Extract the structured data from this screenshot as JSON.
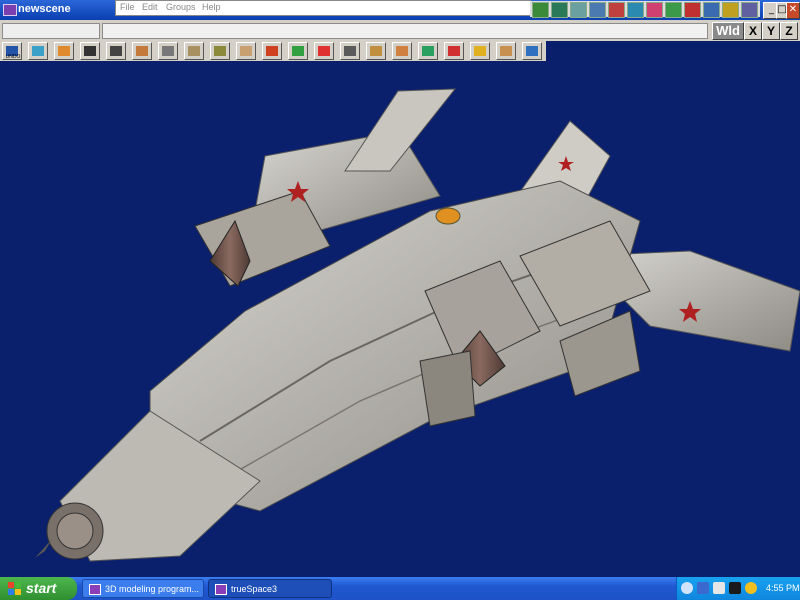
{
  "window": {
    "title": "newscene"
  },
  "menu": [
    "File",
    "Edit",
    "Groups",
    "Help"
  ],
  "window_controls": {
    "minimize": "_",
    "maximize": "□",
    "close": "✕"
  },
  "coord_bar": {
    "wld": "Wld",
    "x": "X",
    "y": "Y",
    "z": "Z"
  },
  "toolbar": {
    "undo_label": "UNDO",
    "tools": [
      {
        "name": "undo-tool",
        "color": "#2255aa"
      },
      {
        "name": "object-tool",
        "color": "#3aa0c8"
      },
      {
        "name": "primitives-tool",
        "color": "#e08a30"
      },
      {
        "name": "navigation-tool",
        "color": "#333333"
      },
      {
        "name": "select-tool",
        "color": "#444444"
      },
      {
        "name": "eye-move-tool",
        "color": "#c47a3a"
      },
      {
        "name": "object-move-tool",
        "color": "#777777"
      },
      {
        "name": "rotate-tool",
        "color": "#a89060"
      },
      {
        "name": "scale-tool",
        "color": "#8a8a3a"
      },
      {
        "name": "paint-tool",
        "color": "#c8a070"
      },
      {
        "name": "material-tool",
        "color": "#d04020"
      },
      {
        "name": "glue-tool",
        "color": "#30a040"
      },
      {
        "name": "light-tool",
        "color": "#e03030"
      },
      {
        "name": "spline-tool",
        "color": "#5a5a5a"
      },
      {
        "name": "deform-tool",
        "color": "#c09040"
      },
      {
        "name": "animate-tool",
        "color": "#d08040"
      },
      {
        "name": "boolean-tool",
        "color": "#2aa060"
      },
      {
        "name": "axes-tool",
        "color": "#d03030"
      },
      {
        "name": "render-tool",
        "color": "#e0b020"
      },
      {
        "name": "scene-tool",
        "color": "#c89050"
      },
      {
        "name": "3d-view-tool",
        "color": "#3070c0"
      }
    ]
  },
  "tooldeck_icons": [
    "#3a8a3a",
    "#2a7a5a",
    "#6aa0a0",
    "#4a7ab0",
    "#c04040",
    "#2a8ab0",
    "#d04070",
    "#3a9a4a",
    "#c03030",
    "#3a6ab0",
    "#c0a020",
    "#6060a0"
  ],
  "taskbar": {
    "start_label": "start",
    "tasks": [
      {
        "label": "3D modeling program..."
      },
      {
        "label": "trueSpace3"
      }
    ],
    "clock": "4:55 PM"
  },
  "colors": {
    "viewport_bg": "#0b206c",
    "hull": "#b8b5ae",
    "hull_dark": "#6a6660",
    "accent_red": "#b02020",
    "nozzle": "#6a5248"
  }
}
